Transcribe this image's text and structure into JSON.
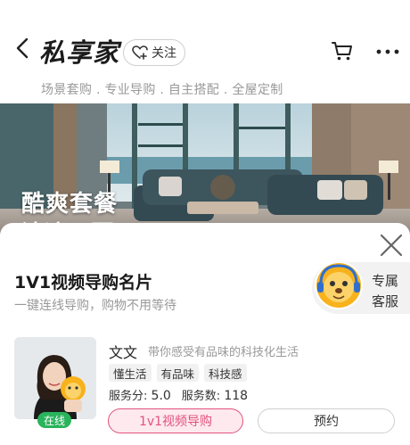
{
  "header": {
    "brand": "私享家",
    "follow_label": "关注",
    "slogan": "场景套购 . 专业导购 . 自主搭配 . 全屋定制"
  },
  "banner": {
    "text_line1": "酷爽套餐",
    "text_line2": "清凉一夏"
  },
  "sheet": {
    "title": "1V1视频导购名片",
    "subtitle": "一键连线导购，购物不用等待",
    "service_label_line1": "专属",
    "service_label_line2": "客服"
  },
  "guide": {
    "name": "文文",
    "tagline": "带你感受有品味的科技化生活",
    "status": "在线",
    "tags": [
      "懂生活",
      "有品味",
      "科技感"
    ],
    "score_label": "服务分:",
    "score_value": "5.0",
    "count_label": "服务数:",
    "count_value": "118",
    "video_button": "1v1视频导购",
    "book_button": "预约"
  },
  "colors": {
    "accent": "#e3527e",
    "accent_bg": "#fde9ee",
    "online": "#29b35c"
  },
  "icons": [
    "back-arrow-icon",
    "heart-plus-icon",
    "cart-icon",
    "more-dots-icon",
    "close-icon",
    "mascot-icon"
  ]
}
